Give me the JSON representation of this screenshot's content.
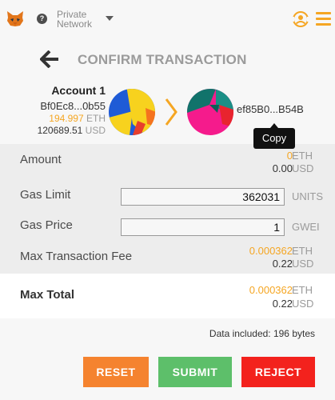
{
  "topbar": {
    "help_icon_glyph": "?",
    "network_line1": "Private",
    "network_line2": "Network",
    "menu_color": "#f5a623"
  },
  "header": {
    "title": "CONFIRM TRANSACTION"
  },
  "from_account": {
    "name": "Account 1",
    "address": "Bf0Ec8...0b55",
    "eth_balance": "194.997",
    "eth_unit": "ETH",
    "usd_balance": "120689.51",
    "usd_unit": "USD"
  },
  "to_account": {
    "address": "ef85B0...B54B"
  },
  "tooltip": {
    "text": "Copy"
  },
  "details": {
    "amount": {
      "label": "Amount",
      "eth": "0",
      "eth_unit": "ETH",
      "usd": "0.00",
      "usd_unit": "USD"
    },
    "gas_limit": {
      "label": "Gas Limit",
      "value": "362031",
      "unit": "UNITS"
    },
    "gas_price": {
      "label": "Gas Price",
      "value": "1",
      "unit": "GWEI"
    },
    "max_fee": {
      "label": "Max Transaction Fee",
      "eth": "0.000362",
      "eth_unit": "ETH",
      "usd": "0.22",
      "usd_unit": "USD"
    }
  },
  "total": {
    "label": "Max Total",
    "eth": "0.000362",
    "eth_unit": "ETH",
    "usd": "0.22",
    "usd_unit": "USD"
  },
  "footer": {
    "data_included": "Data included: 196 bytes",
    "reset_label": "RESET",
    "submit_label": "SUBMIT",
    "reject_label": "REJECT"
  },
  "colors": {
    "accent_orange": "#f5a623",
    "reset_button": "#f5832f",
    "submit_button": "#5dbf6a",
    "reject_button": "#f3221d"
  }
}
